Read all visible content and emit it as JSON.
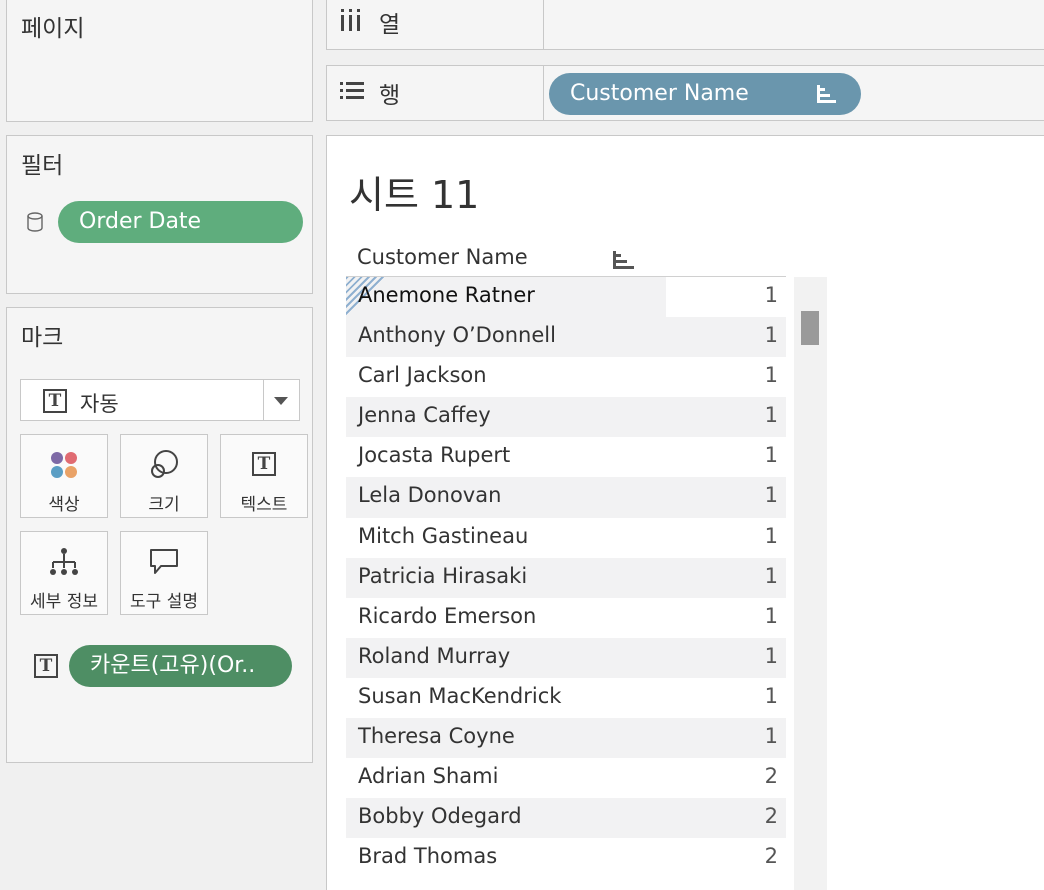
{
  "pages": {
    "title": "페이지"
  },
  "filters": {
    "title": "필터",
    "items": [
      {
        "label": "Order Date",
        "icon": "database-icon",
        "color": "#5fad7d"
      }
    ]
  },
  "marks": {
    "title": "마크",
    "type_select": {
      "value": "자동",
      "icon": "text-icon"
    },
    "buttons": [
      {
        "label": "색상",
        "icon": "color-icon"
      },
      {
        "label": "크기",
        "icon": "size-icon"
      },
      {
        "label": "텍스트",
        "icon": "text-icon"
      },
      {
        "label": "세부 정보",
        "icon": "detail-icon"
      },
      {
        "label": "도구 설명",
        "icon": "tooltip-icon"
      }
    ],
    "cards": [
      {
        "label": "카운트(고유)(Or..",
        "icon": "text-icon",
        "color": "#4e8e64"
      }
    ]
  },
  "shelves": {
    "columns": {
      "label": "열",
      "icon": "columns-icon"
    },
    "rows": {
      "label": "행",
      "icon": "rows-icon",
      "pills": [
        {
          "label": "Customer Name",
          "icon": "sort-icon",
          "color": "#6a96ad"
        }
      ]
    }
  },
  "sheet": {
    "title": "시트 11",
    "column_header": "Customer Name",
    "rows": [
      {
        "name": "Anemone Ratner",
        "value": "1"
      },
      {
        "name": "Anthony O’Donnell",
        "value": "1"
      },
      {
        "name": "Carl Jackson",
        "value": "1"
      },
      {
        "name": "Jenna Caffey",
        "value": "1"
      },
      {
        "name": "Jocasta Rupert",
        "value": "1"
      },
      {
        "name": "Lela Donovan",
        "value": "1"
      },
      {
        "name": "Mitch Gastineau",
        "value": "1"
      },
      {
        "name": "Patricia Hirasaki",
        "value": "1"
      },
      {
        "name": "Ricardo Emerson",
        "value": "1"
      },
      {
        "name": "Roland Murray",
        "value": "1"
      },
      {
        "name": "Susan MacKendrick",
        "value": "1"
      },
      {
        "name": "Theresa Coyne",
        "value": "1"
      },
      {
        "name": "Adrian Shami",
        "value": "2"
      },
      {
        "name": "Bobby Odegard",
        "value": "2"
      },
      {
        "name": "Brad Thomas",
        "value": "2"
      }
    ]
  }
}
